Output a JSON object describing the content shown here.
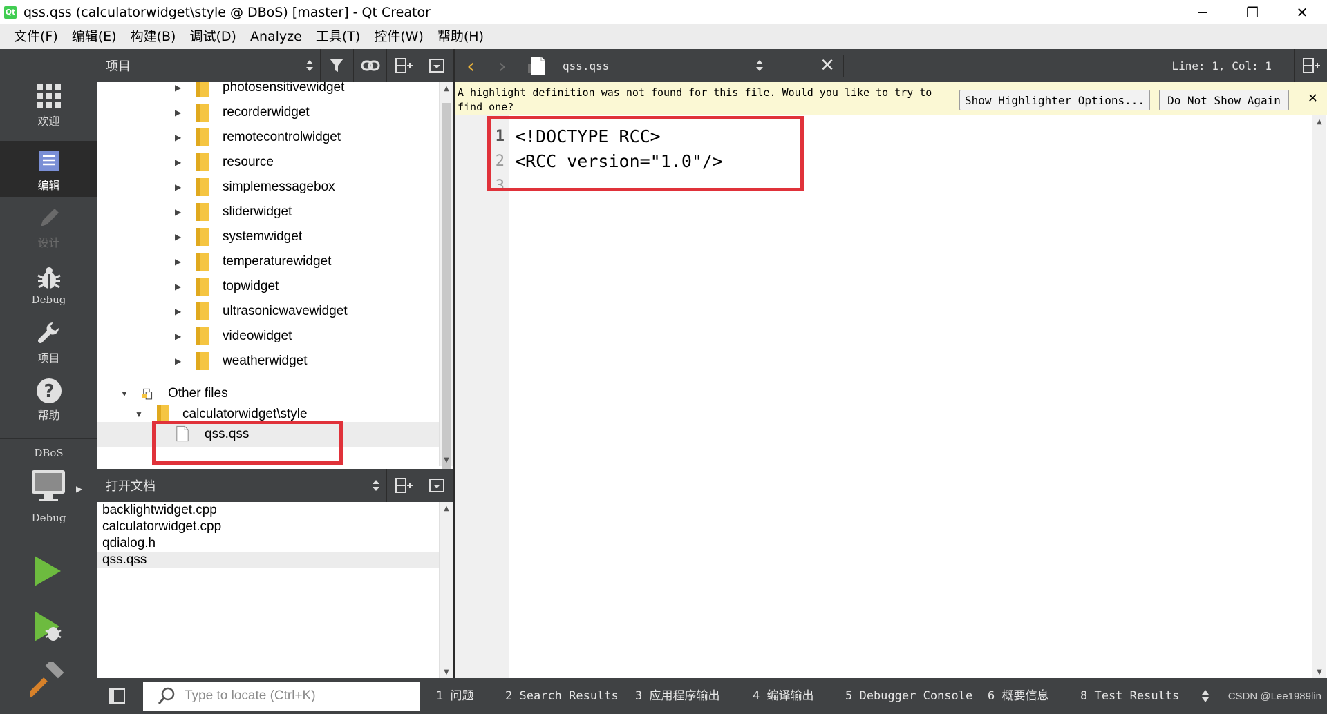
{
  "window": {
    "title": "qss.qss (calculatorwidget\\style @ DBoS) [master] - Qt Creator",
    "logo_text": "Qt",
    "minimize": "─",
    "restore": "❐",
    "close": "✕"
  },
  "menubar": {
    "items": [
      "文件(F)",
      "编辑(E)",
      "构建(B)",
      "调试(D)",
      "Analyze",
      "工具(T)",
      "控件(W)",
      "帮助(H)"
    ]
  },
  "modes": {
    "welcome": "欢迎",
    "edit": "编辑",
    "design": "设计",
    "debug": "Debug",
    "projects": "项目",
    "help": "帮助",
    "kit_project": "DBoS",
    "kit_config": "Debug"
  },
  "projects_pane": {
    "title": "项目",
    "folders": [
      "photosensitivewidget",
      "recorderwidget",
      "remotecontrolwidget",
      "resource",
      "simplemessagebox",
      "sliderwidget",
      "systemwidget",
      "temperaturewidget",
      "topwidget",
      "ultrasonicwavewidget",
      "videowidget",
      "weatherwidget"
    ],
    "other_files": "Other files",
    "subfolder": "calculatorwidget\\style",
    "selected_file": "qss.qss"
  },
  "open_docs": {
    "title": "打开文档",
    "items": [
      "backlightwidget.cpp",
      "calculatorwidget.cpp",
      "qdialog.h",
      "qss.qss"
    ]
  },
  "editor_toolbar": {
    "file_name": "qss.qss",
    "position": "Line: 1, Col: 1"
  },
  "infobar": {
    "message": "A highlight definition was not found for this file. Would you like to try to find one?",
    "show_options": "Show Highlighter Options...",
    "dont_show": "Do Not Show Again",
    "close": "✕"
  },
  "editor": {
    "lines": [
      "<!DOCTYPE RCC>",
      "<RCC version=\"1.0\"/>",
      ""
    ],
    "line_numbers": [
      "1",
      "2",
      "3"
    ]
  },
  "bottombar": {
    "locator_placeholder": "Type to locate (Ctrl+K)",
    "tabs": [
      "1  问题",
      "2  Search Results",
      "3  应用程序输出",
      "4  编译输出",
      "5  Debugger Console",
      "6  概要信息",
      "8  Test Results"
    ],
    "watermark": "CSDN @Lee1989lin"
  },
  "colors": {
    "sidebar": "#404244",
    "highlight_box": "#e0323a",
    "infobar": "#fbf8d4"
  }
}
